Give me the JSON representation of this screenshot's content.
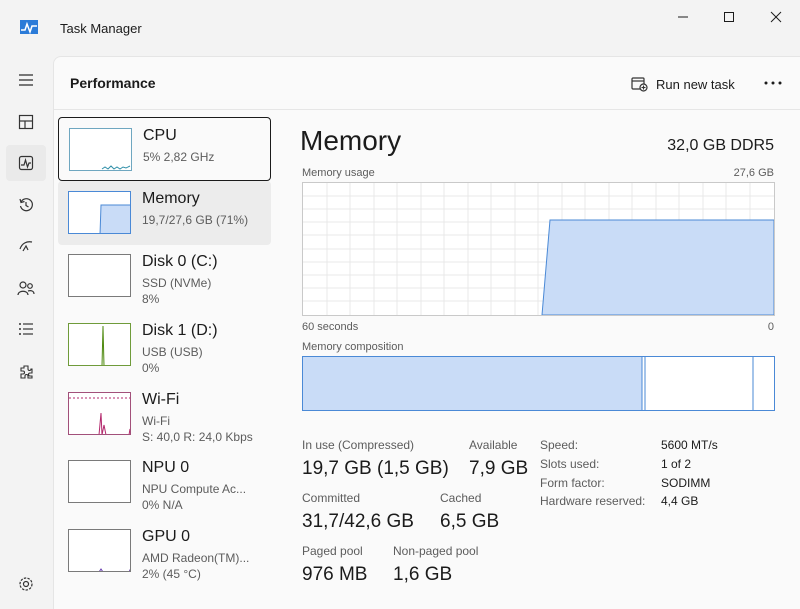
{
  "window": {
    "title": "Task Manager"
  },
  "header": {
    "page_title": "Performance",
    "run_new_task_label": "Run new task"
  },
  "rail": {
    "items": [
      "hamburger-icon",
      "processes-icon",
      "performance-icon",
      "app-history-icon",
      "startup-apps-icon",
      "users-icon",
      "details-icon",
      "services-icon",
      "settings-icon"
    ],
    "active": "performance-icon"
  },
  "resources": [
    {
      "name": "CPU",
      "sub": "5%  2,82 GHz",
      "sub2": ""
    },
    {
      "name": "Memory",
      "sub": "19,7/27,6 GB (71%)",
      "sub2": ""
    },
    {
      "name": "Disk 0 (C:)",
      "sub": "SSD (NVMe)",
      "sub2": "8%"
    },
    {
      "name": "Disk 1 (D:)",
      "sub": "USB (USB)",
      "sub2": "0%"
    },
    {
      "name": "Wi-Fi",
      "sub": "Wi-Fi",
      "sub2": "S: 40,0  R: 24,0 Kbps"
    },
    {
      "name": "NPU 0",
      "sub": "NPU Compute Ac...",
      "sub2": "0%  N/A"
    },
    {
      "name": "GPU 0",
      "sub": "AMD Radeon(TM)...",
      "sub2": "2%  (45 °C)"
    }
  ],
  "detail": {
    "title": "Memory",
    "spec": "32,0 GB DDR5",
    "usage_label": "Memory usage",
    "usage_max": "27,6 GB",
    "time_span": "60 seconds",
    "time_zero": "0",
    "composition_label": "Memory composition",
    "stats": {
      "in_use_label": "In use (Compressed)",
      "in_use_value": "19,7 GB (1,5 GB)",
      "available_label": "Available",
      "available_value": "7,9 GB",
      "committed_label": "Committed",
      "committed_value": "31,7/42,6 GB",
      "cached_label": "Cached",
      "cached_value": "6,5 GB",
      "paged_label": "Paged pool",
      "paged_value": "976 MB",
      "nonpaged_label": "Non-paged pool",
      "nonpaged_value": "1,6 GB"
    },
    "specs": [
      {
        "label": "Speed:",
        "value": "5600 MT/s"
      },
      {
        "label": "Slots used:",
        "value": "1 of 2"
      },
      {
        "label": "Form factor:",
        "value": "SODIMM"
      },
      {
        "label": "Hardware reserved:",
        "value": "4,4 GB"
      }
    ],
    "composition_segments": {
      "in_use": 19.7,
      "modified": 0.1,
      "standby": 6.5,
      "free": 1.3
    }
  },
  "colors": {
    "memory_stroke": "#4a89d6",
    "memory_fill": "#c9dcf7",
    "cpu_line": "#2f8fa8",
    "disk1_line": "#4f8a10",
    "wifi_line": "#b3286c",
    "gpu_line": "#6a3fb0",
    "accent": "#005fb8"
  }
}
